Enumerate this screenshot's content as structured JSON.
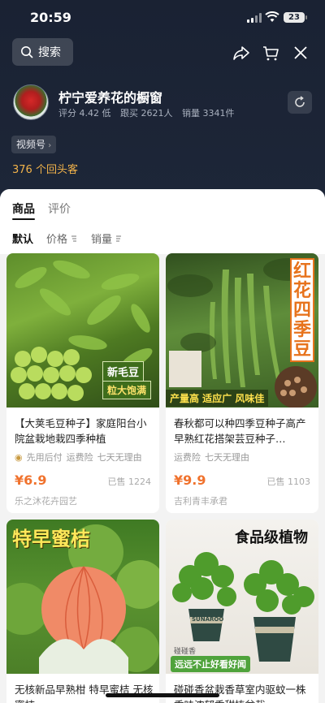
{
  "status_bar": {
    "time": "20:59",
    "battery": "23"
  },
  "search": {
    "label": "搜索"
  },
  "shop": {
    "name": "柠宁爱养花的橱窗",
    "rating": "评分 4.42 低",
    "followers": "跟买 2621人",
    "sales": "销量 3341件",
    "video_tag": "视频号",
    "returning": "376 个回头客"
  },
  "tabs": {
    "products": "商品",
    "reviews": "评价"
  },
  "sort": {
    "default": "默认",
    "price": "价格",
    "sales": "销量"
  },
  "products": [
    {
      "title": "【大荚毛豆种子】家庭阳台小院盆栽地栽四季种植",
      "tags": [
        "先用后付",
        "运费险",
        "七天无理由"
      ],
      "price": "¥6.9",
      "sold": "已售 1224",
      "seller": "乐之沐花卉园艺",
      "img_text": [
        "新毛豆",
        "粒大饱满"
      ]
    },
    {
      "title": "春秋都可以种四季豆种子高产早熟红花搭架芸豆种子…",
      "tags": [
        "运费险",
        "七天无理由"
      ],
      "price": "¥9.9",
      "sold": "已售 1103",
      "seller": "吉利青丰承君",
      "img_text": [
        "红花四季豆",
        "产量高 适应广 风味佳"
      ]
    },
    {
      "title": "无核新品早熟柑 特早蜜桔 无核蜜桔",
      "img_text": [
        "特早蜜桔"
      ]
    },
    {
      "title": "碰碰香盆栽香草室内驱蚊一株香味浓郁香甜植盆栽",
      "img_text": [
        "食品级植物",
        "SUNAROO",
        "碰碰香",
        "远远不止好看好闻"
      ]
    }
  ],
  "colors": {
    "accent": "#f0722d",
    "gold": "#f2b34a"
  }
}
